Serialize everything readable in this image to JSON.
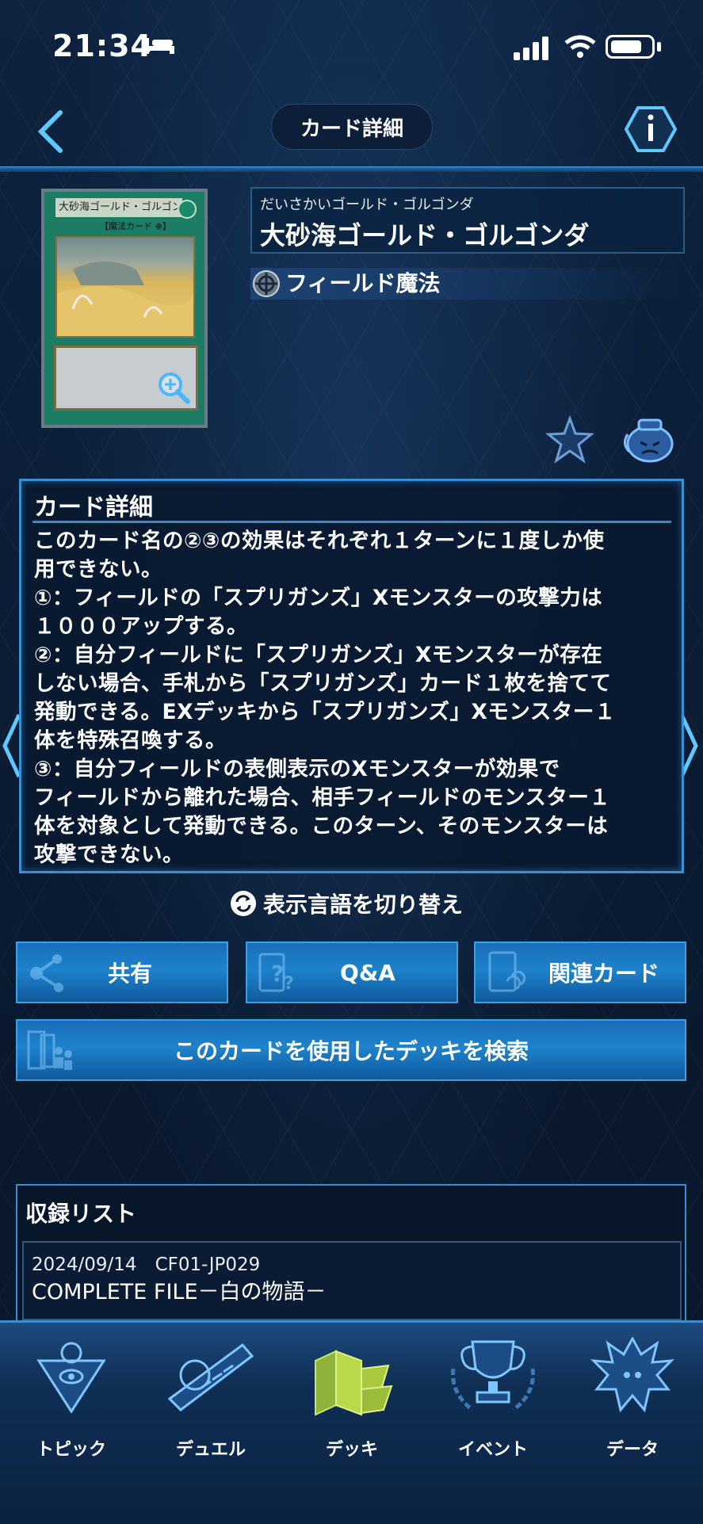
{
  "status_bar": {
    "time": "21:34"
  },
  "header": {
    "title": "カード詳細"
  },
  "card": {
    "ruby": "だいさかいゴールド・ゴルゴンダ",
    "name": "大砂海ゴールド・ゴルゴンダ",
    "type": "フィールド魔法",
    "image_name_text": "大砂海ゴールド・ゴルゴンダ",
    "image_type_text": "【魔法カード ⊕】"
  },
  "detail": {
    "title": "カード詳細",
    "text": "このカード名の②③の効果はそれぞれ１ターンに１度しか使\n用できない。\n①：フィールドの「スプリガンズ」Xモンスターの攻撃力は\n１０００アップする。\n②：自分フィールドに「スプリガンズ」Xモンスターが存在\nしない場合、手札から「スプリガンズ」カード１枚を捨てて\n発動できる。EXデッキから「スプリガンズ」Xモンスター１\n体を特殊召喚する。\n③：自分フィールドの表側表示のXモンスターが効果で\nフィールドから離れた場合、相手フィールドのモンスター１\n体を対象として発動できる。このターン、そのモンスターは\n攻撃できない。"
  },
  "language_toggle": {
    "label": "表示言語を切り替え"
  },
  "buttons": {
    "share": "共有",
    "qa": "Q&A",
    "related": "関連カード",
    "search_decks": "このカードを使用したデッキを検索"
  },
  "recorded": {
    "title": "収録リスト",
    "items": [
      {
        "date_code": "2024/09/14　CF01-JP029",
        "name": "COMPLETE FILE－白の物語－"
      }
    ]
  },
  "tabbar": {
    "items": [
      {
        "label": "トピック",
        "icon": "topic-icon"
      },
      {
        "label": "デュエル",
        "icon": "duel-icon"
      },
      {
        "label": "デッキ",
        "icon": "deck-icon"
      },
      {
        "label": "イベント",
        "icon": "event-icon"
      },
      {
        "label": "データ",
        "icon": "data-icon"
      }
    ],
    "active": "デッキ"
  },
  "colors": {
    "accent": "#3b8fd0",
    "button": "#1a6fb8",
    "active_tab": "#b9d84a"
  }
}
